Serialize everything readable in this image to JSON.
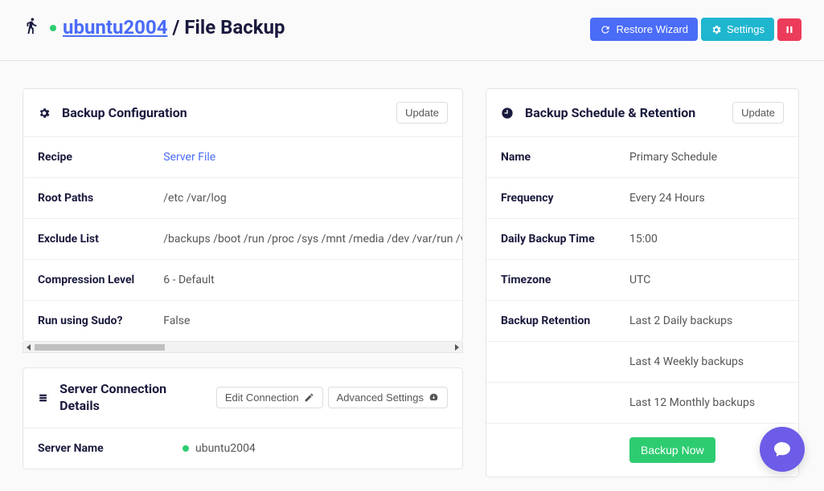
{
  "header": {
    "server_name": "ubuntu2004",
    "separator": "/",
    "backup_type": "File Backup",
    "restore_label": "Restore Wizard",
    "settings_label": "Settings"
  },
  "config": {
    "title": "Backup Configuration",
    "update_label": "Update",
    "rows": {
      "recipe_label": "Recipe",
      "recipe_value": "Server File",
      "root_paths_label": "Root Paths",
      "root_paths_value": "/etc /var/log",
      "exclude_label": "Exclude List",
      "exclude_value": "/backups /boot /run /proc /sys /mnt /media /dev /var/run /var/lock",
      "compression_label": "Compression Level",
      "compression_value": "6 - Default",
      "sudo_label": "Run using Sudo?",
      "sudo_value": "False"
    }
  },
  "connection": {
    "title": "Server Connection Details",
    "edit_label": "Edit Connection",
    "advanced_label": "Advanced Settings",
    "rows": {
      "server_name_label": "Server Name",
      "server_name_value": "ubuntu2004"
    }
  },
  "schedule": {
    "title": "Backup Schedule & Retention",
    "update_label": "Update",
    "rows": {
      "name_label": "Name",
      "name_value": "Primary Schedule",
      "frequency_label": "Frequency",
      "frequency_value": "Every 24 Hours",
      "daily_time_label": "Daily Backup Time",
      "daily_time_value": "15:00",
      "timezone_label": "Timezone",
      "timezone_value": "UTC",
      "retention_label": "Backup Retention",
      "retention_daily": "Last 2 Daily backups",
      "retention_weekly": "Last 4 Weekly backups",
      "retention_monthly": "Last 12 Monthly backups"
    },
    "backup_now_label": "Backup Now"
  }
}
